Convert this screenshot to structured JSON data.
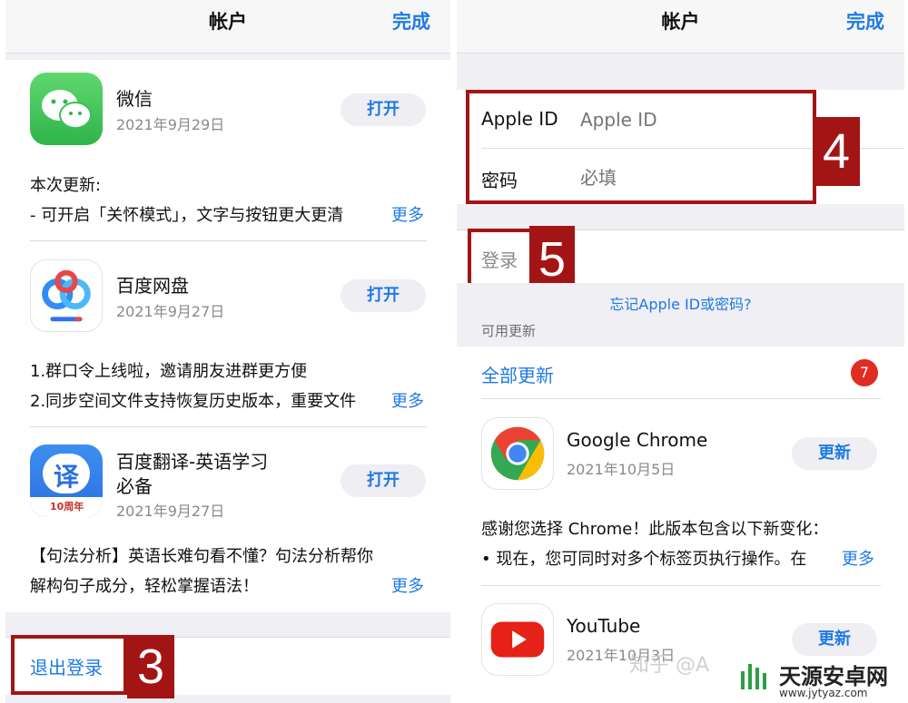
{
  "left": {
    "nav": {
      "title": "帐户",
      "done": "完成"
    },
    "apps": [
      {
        "name": "微信",
        "date": "2021年9月29日",
        "button": "打开",
        "icon": "wechat-icon",
        "desc_title": "本次更新:",
        "desc_line": "- 可开启「关怀模式」，文字与按钮更大更清",
        "more": "更多"
      },
      {
        "name": "百度网盘",
        "date": "2021年9月27日",
        "button": "打开",
        "icon": "baidu-netdisk-icon",
        "desc_title": "1.群口令上线啦，邀请朋友进群更方便",
        "desc_line": "2.同步空间文件支持恢复历史版本，重要文件",
        "more": "更多"
      },
      {
        "name": "百度翻译-英语学习",
        "name2": "必备",
        "date": "2021年9月27日",
        "button": "打开",
        "icon": "baidu-translate-icon",
        "icon_text": "译",
        "icon_sub": "10周年",
        "desc_title": "【句法分析】英语长难句看不懂？句法分析帮你",
        "desc_line": "解构句子成分，轻松掌握语法！",
        "more": "更多"
      }
    ],
    "signout": "退出登录",
    "step3": "3"
  },
  "right": {
    "nav": {
      "title": "帐户",
      "done": "完成"
    },
    "appleid_label": "Apple ID",
    "appleid_placeholder": "Apple ID",
    "password_label": "密码",
    "password_placeholder": "必填",
    "step4": "4",
    "signin": "登录",
    "step5": "5",
    "forgot": "忘记Apple ID或密码?",
    "updates_header": "可用更新",
    "update_all": "全部更新",
    "badge_count": "7",
    "apps": [
      {
        "name": "Google Chrome",
        "date": "2021年10月5日",
        "button": "更新",
        "icon": "chrome-icon",
        "desc_title": "感谢您选择 Chrome！此版本包含以下新变化：",
        "desc_line": "• 现在，您可同时对多个标签页执行操作。在",
        "more": "更多"
      },
      {
        "name": "YouTube",
        "date": "2021年10月3日",
        "button": "更新",
        "icon": "youtube-icon"
      }
    ]
  },
  "watermark": {
    "zhihu": "知乎 @A",
    "site": "天源安卓网",
    "url": "www.jytyaz.com"
  },
  "colors": {
    "accent": "#1f7ae3",
    "annotation_red": "#a31515",
    "badge_red": "#e22b22"
  }
}
